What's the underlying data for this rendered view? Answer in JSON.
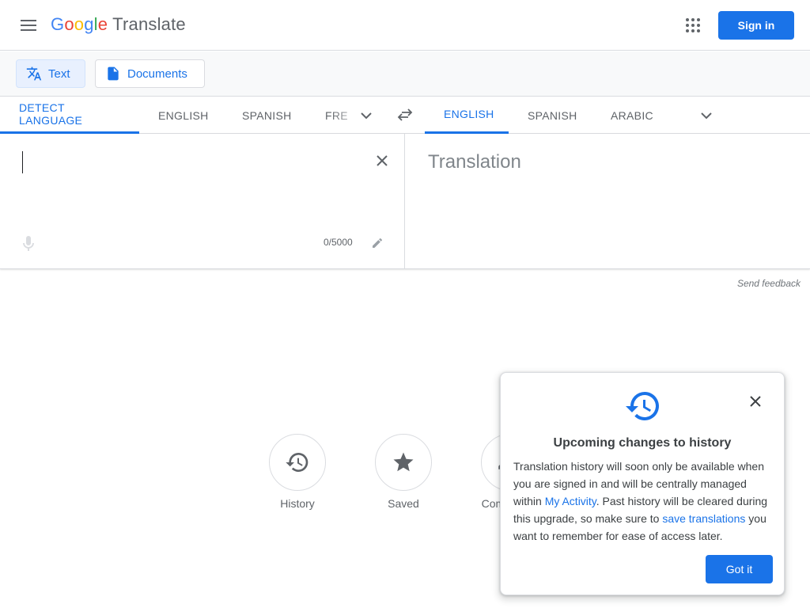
{
  "header": {
    "logo_letters": [
      "G",
      "o",
      "o",
      "g",
      "l",
      "e"
    ],
    "product_name": "Translate",
    "signin_label": "Sign in"
  },
  "modes": {
    "text_label": "Text",
    "documents_label": "Documents"
  },
  "source_languages": {
    "tabs": [
      {
        "label": "DETECT LANGUAGE",
        "active": true
      },
      {
        "label": "ENGLISH",
        "active": false
      },
      {
        "label": "SPANISH",
        "active": false
      },
      {
        "label": "FRE",
        "active": false
      }
    ]
  },
  "target_languages": {
    "tabs": [
      {
        "label": "ENGLISH",
        "active": true
      },
      {
        "label": "SPANISH",
        "active": false
      },
      {
        "label": "ARABIC",
        "active": false
      }
    ]
  },
  "source": {
    "value": "",
    "char_count": "0/5000"
  },
  "target": {
    "placeholder": "Translation"
  },
  "feedback_label": "Send feedback",
  "bottom_actions": [
    {
      "label": "History",
      "icon": "history-icon"
    },
    {
      "label": "Saved",
      "icon": "star-icon"
    },
    {
      "label": "Community",
      "icon": "community-icon"
    }
  ],
  "popup": {
    "title": "Upcoming changes to history",
    "body_part1": "Translation history will soon only be available when you are signed in and will be centrally managed within ",
    "link1": "My Activity",
    "body_part2": ". Past history will be cleared during this upgrade, so make sure to ",
    "link2": "save translations",
    "body_part3": " you want to remember for ease of access later.",
    "button_label": "Got it"
  },
  "colors": {
    "accent": "#1a73e8",
    "text": "#3c4043",
    "muted": "#5f6368",
    "border": "#dadce0"
  }
}
